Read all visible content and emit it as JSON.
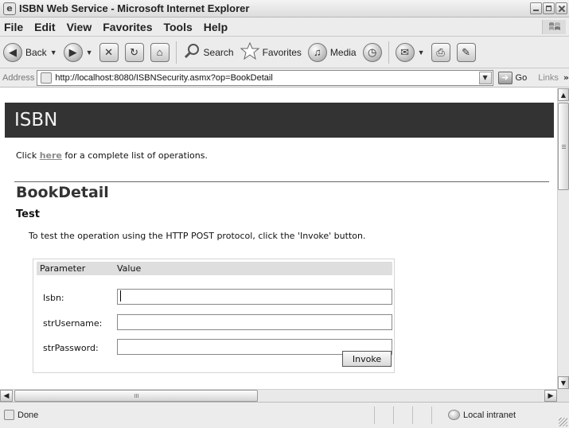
{
  "window": {
    "title": "ISBN Web Service - Microsoft Internet Explorer",
    "app_icon_glyph": "e"
  },
  "menu": {
    "items": [
      "File",
      "Edit",
      "View",
      "Favorites",
      "Tools",
      "Help"
    ]
  },
  "toolbar": {
    "back_label": "Back",
    "search_label": "Search",
    "favorites_label": "Favorites",
    "media_label": "Media"
  },
  "address": {
    "label": "Address",
    "url": "http://localhost:8080/ISBNSecurity.asmx?op=BookDetail",
    "go_label": "Go",
    "links_label": "Links"
  },
  "page": {
    "banner_title": "ISBN",
    "intro_prefix": "Click ",
    "intro_link": "here",
    "intro_suffix": " for a complete list of operations.",
    "operation_title": "BookDetail",
    "test_heading": "Test",
    "test_description": "To test the operation using the HTTP POST protocol, click the 'Invoke' button.",
    "table": {
      "header_parameter": "Parameter",
      "header_value": "Value",
      "rows": [
        {
          "label": "Isbn:",
          "value": ""
        },
        {
          "label": "strUsername:",
          "value": ""
        },
        {
          "label": "strPassword:",
          "value": ""
        }
      ]
    },
    "invoke_label": "Invoke"
  },
  "status": {
    "text": "Done",
    "zone": "Local intranet"
  },
  "colors": {
    "banner_bg": "#333333",
    "banner_text": "#f2f2f2",
    "link": "#8a8a8a"
  }
}
